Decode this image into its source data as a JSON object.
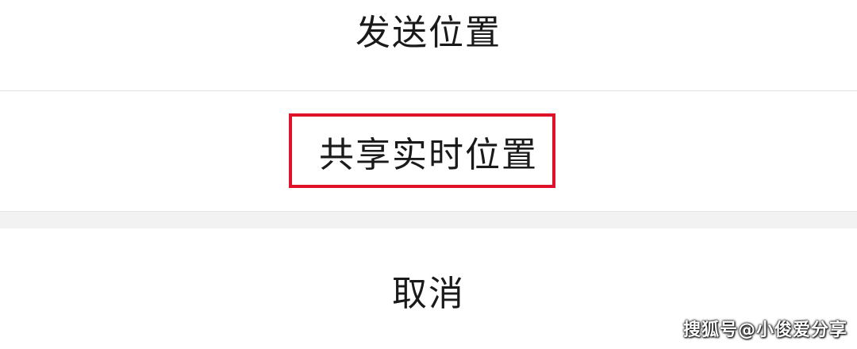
{
  "action_sheet": {
    "options": [
      {
        "label": "发送位置"
      },
      {
        "label": "共享实时位置"
      }
    ],
    "cancel_label": "取消",
    "highlight_color": "#e0122a"
  },
  "watermark": {
    "text": "搜狐号@小俊爱分享"
  }
}
